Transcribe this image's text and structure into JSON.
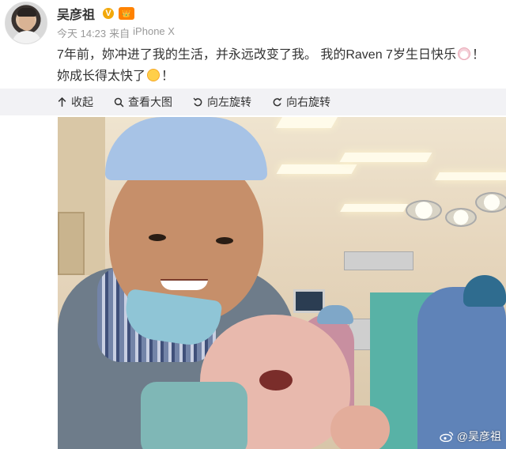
{
  "post": {
    "author_name": "吴彦祖",
    "verified_mark": "V",
    "vip_badge": "👑",
    "time": "今天 14:23",
    "source_prefix": "来自",
    "source": "iPhone X",
    "text_part1": "7年前，妳冲进了我的生活，并永远改变了我。 我的Raven 7岁生日快乐",
    "text_part2": "！ 妳成长得太快了",
    "text_part3": "！"
  },
  "toolbar": {
    "collapse_label": "收起",
    "view_large_label": "查看大图",
    "rotate_left_label": "向左旋转",
    "rotate_right_label": "向右旋转"
  },
  "photo": {
    "watermark": "@吴彦祖"
  },
  "colors": {
    "toolbar_bg": "#f2f2f5",
    "meta_text": "#999999",
    "verified": "#f2a80b"
  },
  "icons": [
    "collapse-arrow-icon",
    "search-icon",
    "rotate-left-icon",
    "rotate-right-icon",
    "weibo-icon"
  ]
}
